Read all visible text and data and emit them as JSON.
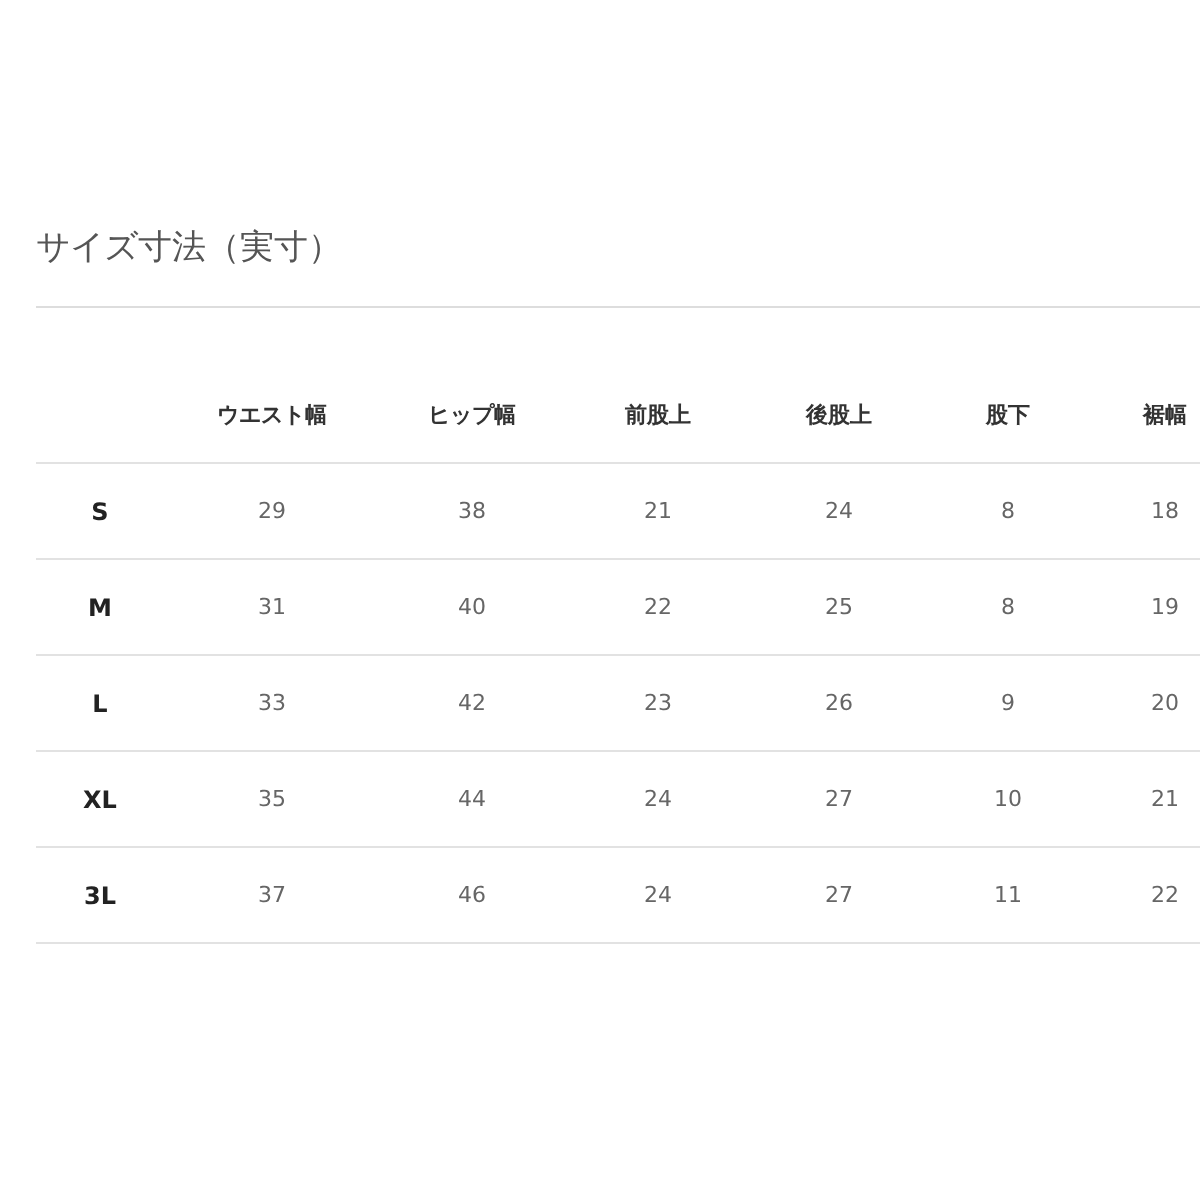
{
  "title": "サイズ寸法（実寸）",
  "table": {
    "columns": [
      "ウエスト幅",
      "ヒップ幅",
      "前股上",
      "後股上",
      "股下",
      "裾幅"
    ],
    "rows": [
      {
        "size": "S",
        "values": [
          "29",
          "38",
          "21",
          "24",
          "8",
          "18"
        ]
      },
      {
        "size": "M",
        "values": [
          "31",
          "40",
          "22",
          "25",
          "8",
          "19"
        ]
      },
      {
        "size": "L",
        "values": [
          "33",
          "42",
          "23",
          "26",
          "9",
          "20"
        ]
      },
      {
        "size": "XL",
        "values": [
          "35",
          "44",
          "24",
          "27",
          "10",
          "21"
        ]
      },
      {
        "size": "3L",
        "values": [
          "37",
          "46",
          "24",
          "27",
          "11",
          "22"
        ]
      }
    ]
  }
}
